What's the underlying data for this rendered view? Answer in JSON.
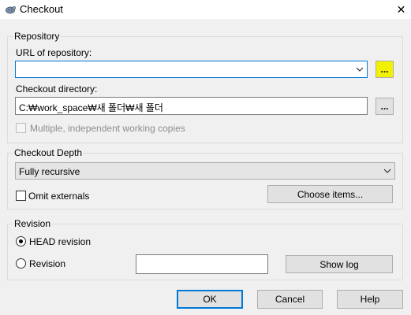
{
  "window": {
    "title": "Checkout",
    "app_icon": "tortoise-icon",
    "close_glyph": "✕"
  },
  "repository": {
    "group_label": "Repository",
    "url_label": "URL of repository:",
    "url_value": "",
    "url_browse_label": "...",
    "url_browse_highlight_color": "#f2f200",
    "dir_label": "Checkout directory:",
    "dir_value": "C:₩work_space₩새 폴더₩새 폴더",
    "dir_browse_label": "...",
    "multiple_label": "Multiple, independent working copies",
    "multiple_checked": false
  },
  "depth": {
    "group_label": "Checkout Depth",
    "selected": "Fully recursive",
    "omit_label": "Omit externals",
    "omit_checked": false,
    "choose_items_label": "Choose items..."
  },
  "revision": {
    "group_label": "Revision",
    "head_label": "HEAD revision",
    "head_selected": true,
    "revision_label": "Revision",
    "revision_value": "",
    "show_log_label": "Show log"
  },
  "footer": {
    "ok_label": "OK",
    "cancel_label": "Cancel",
    "help_label": "Help"
  },
  "colors": {
    "accent": "#0078d7",
    "background": "#f0f0f0"
  }
}
